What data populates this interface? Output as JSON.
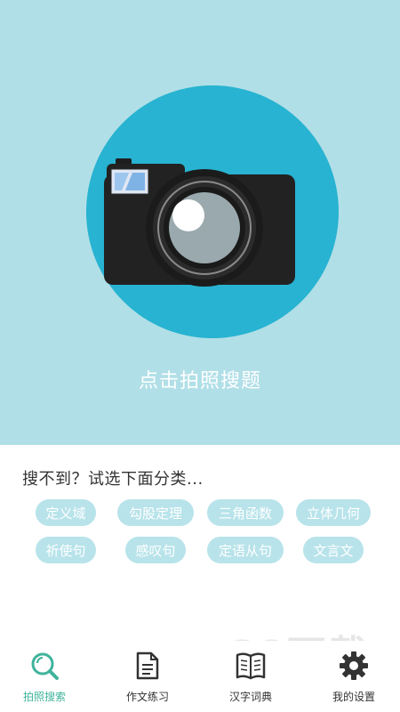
{
  "hero": {
    "label": "点击拍照搜题",
    "background": "#b1dfe7",
    "circle_color": "#27b3d1"
  },
  "categories": {
    "title": "搜不到？试选下面分类...",
    "chip_color": "#b8e3ea",
    "row1": [
      "定义域",
      "勾股定理",
      "三角函数",
      "立体几何"
    ],
    "row2": [
      "祈使句",
      "感叹句",
      "定语从句",
      "文言文"
    ]
  },
  "tabbar": {
    "active_color": "#3fb39c",
    "tabs": [
      {
        "label": "拍照搜索",
        "icon": "search-icon"
      },
      {
        "label": "作文练习",
        "icon": "document-icon"
      },
      {
        "label": "汉字词典",
        "icon": "book-icon"
      },
      {
        "label": "我的设置",
        "icon": "gear-icon"
      }
    ]
  },
  "watermark": {
    "text": "G8下载"
  }
}
